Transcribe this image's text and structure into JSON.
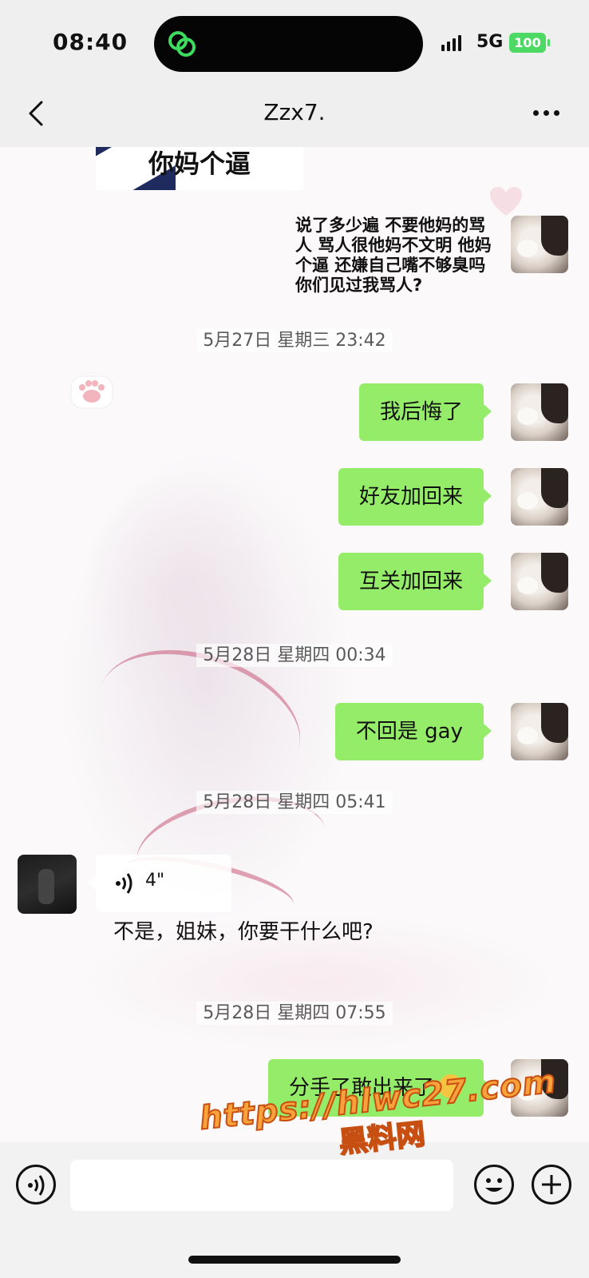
{
  "status_bar": {
    "time": "08:40",
    "network": "5G",
    "battery": "100"
  },
  "nav": {
    "title": "Zzx7."
  },
  "messages": {
    "image_caption": "你妈个逼",
    "long_text": "说了多少遍 不要他妈的骂人 骂人很他妈不文明 他妈个逼 还嫌自己嘴不够臭吗 你们见过我骂人?",
    "ts1": "5月27日 星期三 23:42",
    "m1": "我后悔了",
    "m2": "好友加回来",
    "m3": "互关加回来",
    "ts2": "5月28日 星期四 00:34",
    "m4": "不回是 gay",
    "ts3": "5月28日 星期四 05:41",
    "voice_duration": "4\"",
    "transcript": "不是，姐妹，你要干什么吧?",
    "ts4": "5月28日 星期四 07:55",
    "m5": "分手了敢出来了"
  },
  "watermark": {
    "url": "https://hlwc27.com",
    "name": "黑料网"
  },
  "colors": {
    "bubble_me": "#95ec69",
    "bar_bg": "#efefef"
  },
  "icons": [
    "back-icon",
    "more-icon",
    "voice-icon",
    "emoji-icon",
    "plus-icon",
    "paw-icon",
    "heart-icon",
    "signal-icon",
    "battery-icon",
    "chat-app-icon"
  ]
}
